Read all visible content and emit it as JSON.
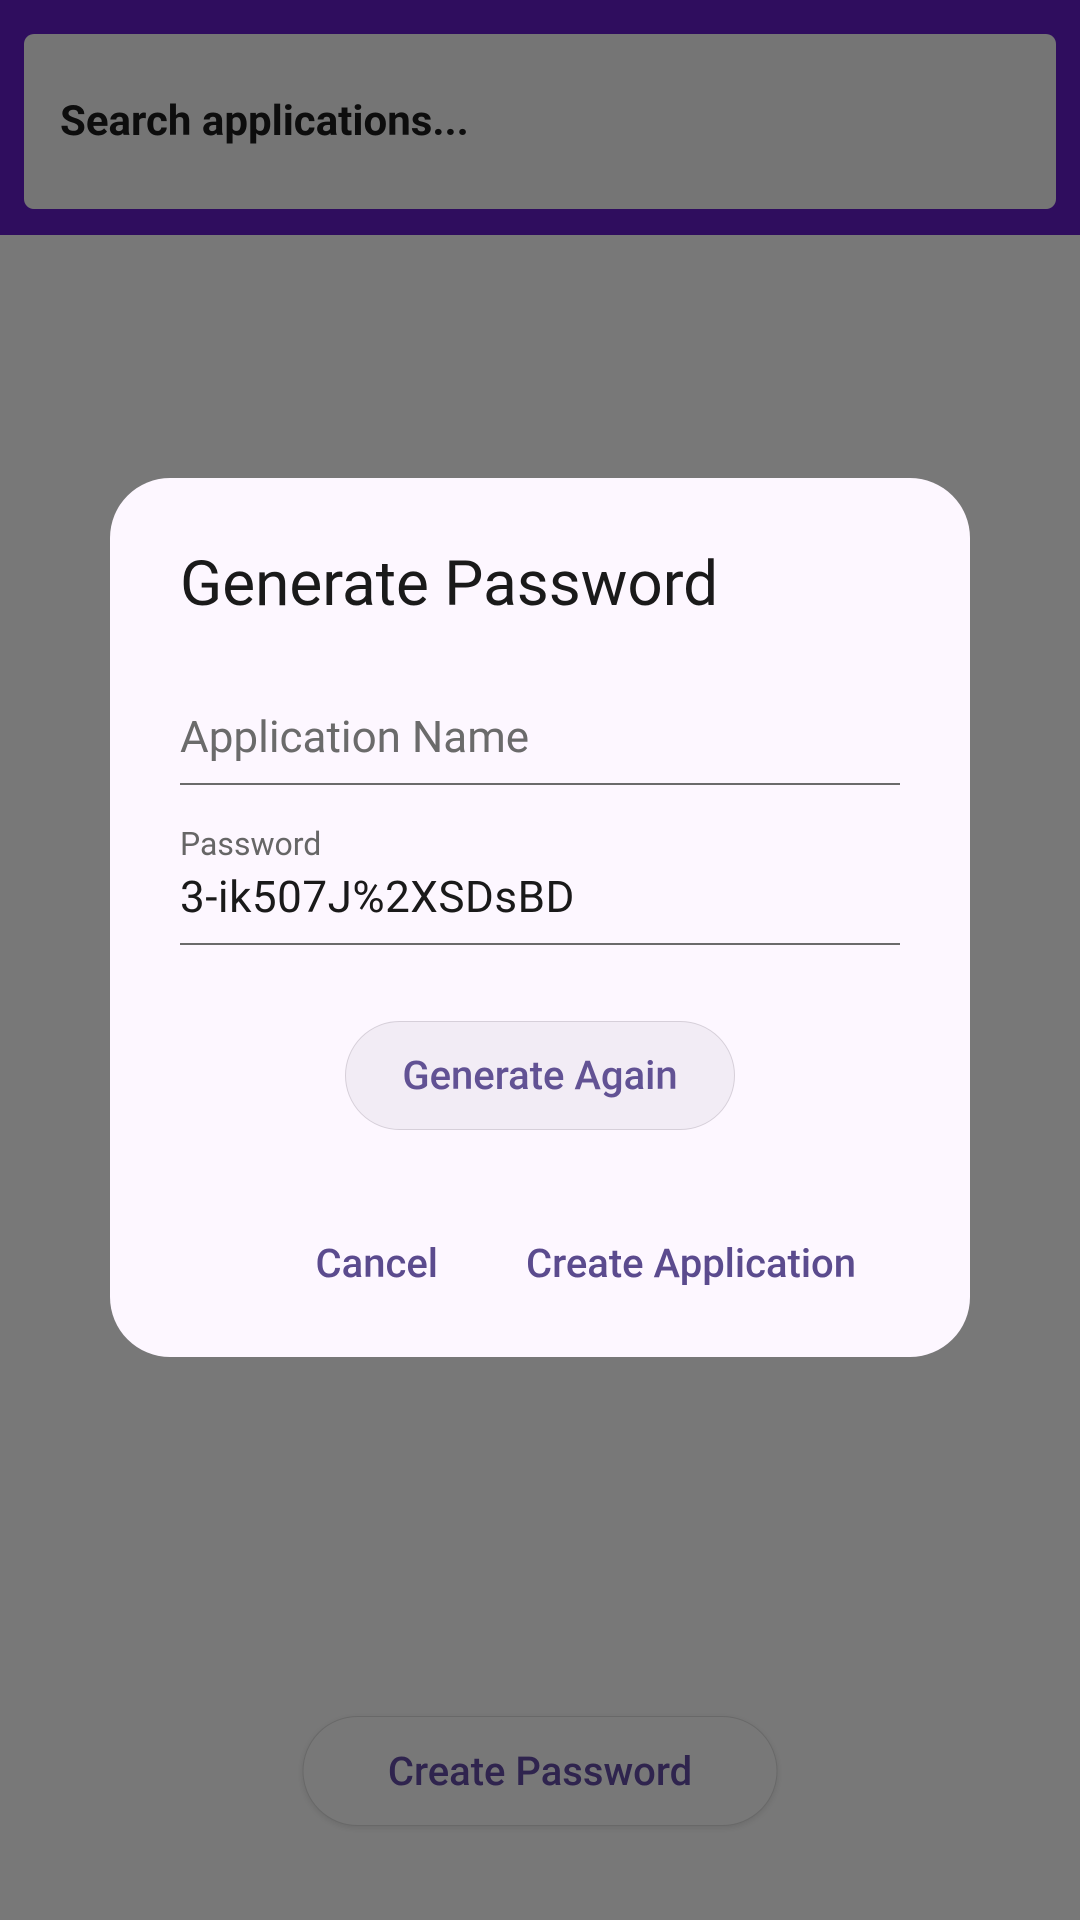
{
  "header": {
    "search_placeholder": "Search applications..."
  },
  "main": {
    "create_password_label": "Create Password"
  },
  "dialog": {
    "title": "Generate Password",
    "app_name_label": "Application Name",
    "app_name_value": "",
    "password_label": "Password",
    "password_value": "3-ik507J%2XSDsBD",
    "generate_again_label": "Generate Again",
    "cancel_label": "Cancel",
    "create_label": "Create Application"
  },
  "colors": {
    "brand_purple": "#5a1ab5",
    "action_purple": "#5b4b8e",
    "dialog_bg": "#fdf7ff"
  }
}
